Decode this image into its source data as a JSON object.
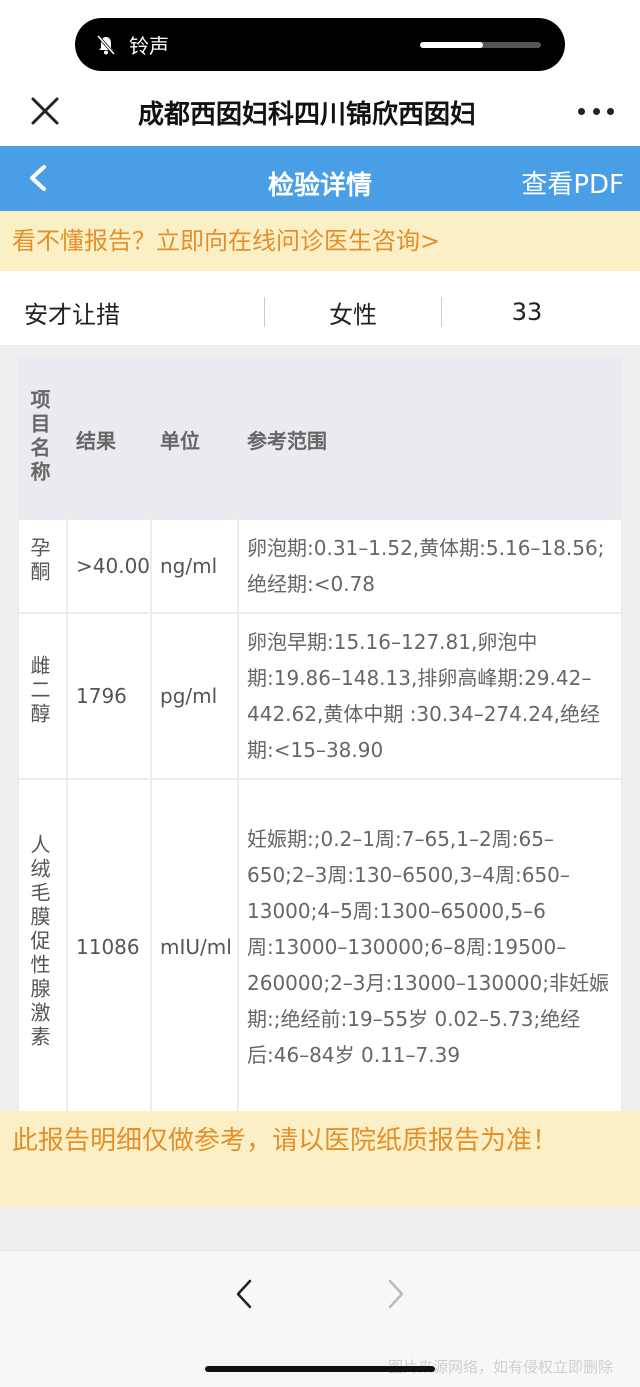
{
  "status": {
    "ringer_label": "铃声",
    "ringer_icon": "bell-muted-icon",
    "volume_fraction": 0.52
  },
  "titlebar": {
    "title": "成都西囡妇科四川锦欣西囡妇"
  },
  "header": {
    "title": "检验详情",
    "pdf_label": "查看PDF",
    "bg_color": "#4a9ee6"
  },
  "banner": {
    "text": "看不懂报告？立即向在线问诊医生咨询>"
  },
  "patient": {
    "name": "安才让措",
    "gender": "女性",
    "age": "33"
  },
  "table": {
    "headers": {
      "name": "项目名称",
      "result": "结果",
      "unit": "单位",
      "range": "参考范围"
    },
    "rows": [
      {
        "name": "孕酮",
        "result": ">40.00",
        "unit": "ng/ml",
        "range": "卵泡期:0.31–1.52,黄体期:5.16–18.56;绝经期:<0.78"
      },
      {
        "name": "雌二醇",
        "result": "1796",
        "unit": "pg/ml",
        "range": "卵泡早期:15.16–127.81,卵泡中期:19.86–148.13,排卵高峰期:29.42–442.62,黄体中期 :30.34–274.24,绝经期:<15–38.90"
      },
      {
        "name": "人绒毛膜促性腺激素",
        "result": "11086",
        "unit": "mIU/ml",
        "range": "妊娠期:;0.2–1周:7–65,1–2周:65–650;2–3周:130–6500,3–4周:650–13000;4–5周:1300–65000,5–6周:13000–130000;6–8周:19500–260000;2–3月:13000–130000;非妊娠期:;绝经前:19–55岁 0.02–5.73;绝经后:46–84岁 0.11–7.39"
      }
    ]
  },
  "notice": {
    "text": "此报告明细仅做参考，请以医院纸质报告为准！"
  },
  "watermark": "图片来源网络，如有侵权立即删除"
}
